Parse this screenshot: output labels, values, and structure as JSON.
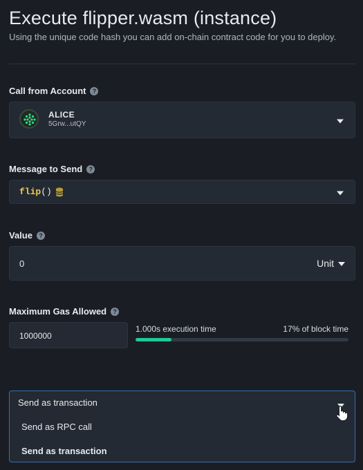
{
  "header": {
    "title": "Execute flipper.wasm (instance)",
    "subtitle": "Using the unique code hash you can add on-chain contract code for you to deploy."
  },
  "call_from_account": {
    "label": "Call from Account",
    "account_name": "ALICE",
    "account_address": "5Grw...utQY"
  },
  "message_to_send": {
    "label": "Message to Send",
    "function_name": "flip",
    "function_suffix": "()"
  },
  "value": {
    "label": "Value",
    "amount": "0",
    "unit": "Unit"
  },
  "gas": {
    "label": "Maximum Gas Allowed",
    "value": "1000000",
    "execution_time": "1.000s execution time",
    "block_time": "17% of block time",
    "fill_percent": 17
  },
  "send_mode": {
    "selected": "Send as transaction",
    "options": [
      "Send as RPC call",
      "Send as transaction"
    ]
  },
  "icons": {
    "help": "help-circle-icon",
    "dropdown": "chevron-down-icon",
    "database": "database-icon",
    "cursor": "hand-pointer-icon"
  },
  "colors": {
    "accent": "#20c997",
    "function_yellow": "#f2c94c",
    "focus_blue": "#3a6fb0"
  }
}
